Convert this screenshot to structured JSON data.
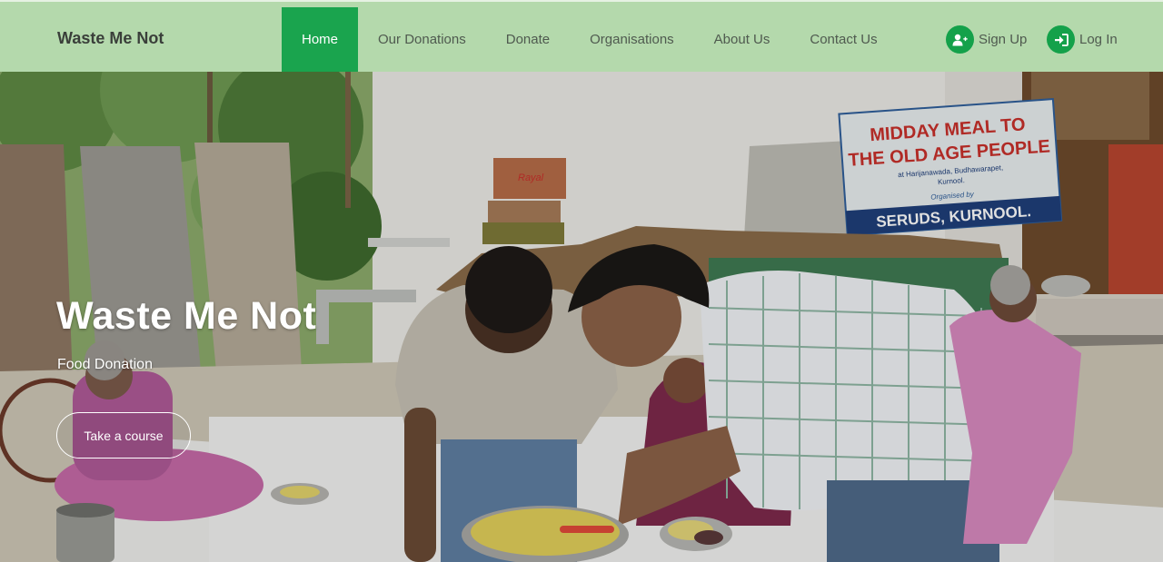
{
  "navbar": {
    "brand": "Waste Me Not",
    "links": [
      {
        "label": "Home",
        "active": true
      },
      {
        "label": "Our Donations",
        "active": false
      },
      {
        "label": "Donate",
        "active": false
      },
      {
        "label": "Organisations",
        "active": false
      },
      {
        "label": "About Us",
        "active": false
      },
      {
        "label": "Contact Us",
        "active": false
      }
    ],
    "signup": {
      "label": "Sign Up",
      "icon": "user-plus-icon"
    },
    "login": {
      "label": "Log In",
      "icon": "sign-in-icon"
    }
  },
  "hero": {
    "title": "Waste Me Not",
    "subtitle": "Food Donation",
    "button_label": "Take a course",
    "banner": {
      "line1": "MIDDAY MEAL TO",
      "line2": "THE OLD AGE PEOPLE",
      "line3": "at Harijanawada, Budhawarapet,",
      "line4": "Kurnool.",
      "organised_by": "Organised by",
      "org": "SERUDS, KURNOOL."
    },
    "box_label": "Rayal"
  },
  "colors": {
    "navbar_bg": "#b4d9ac",
    "accent": "#1aa44e",
    "icon_bg": "#14a14a",
    "nav_text": "#4f5a4f"
  }
}
